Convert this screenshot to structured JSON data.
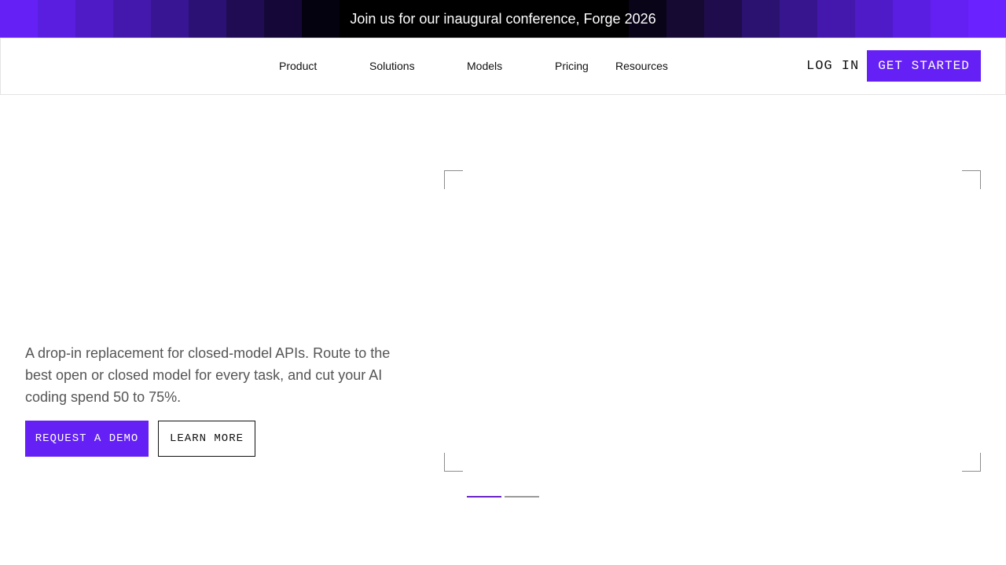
{
  "banner": {
    "text": "Join us for our inaugural conference, Forge 2026"
  },
  "nav": {
    "links": [
      "Product",
      "Solutions",
      "Models",
      "Pricing",
      "Resources"
    ],
    "login_label": "LOG IN",
    "cta_label": "GET STARTED"
  },
  "hero": {
    "description": "A drop-in replacement for closed-model APIs. Route to the best open or closed model for every task, and cut your AI coding spend 50 to 75%.",
    "primary_cta": "REQUEST A DEMO",
    "secondary_cta": "LEARN MORE"
  },
  "carousel": {
    "active_index": 1,
    "total": 2
  },
  "colors": {
    "accent": "#6521f5",
    "banner_dark": "#000000",
    "text_muted": "#555555"
  }
}
